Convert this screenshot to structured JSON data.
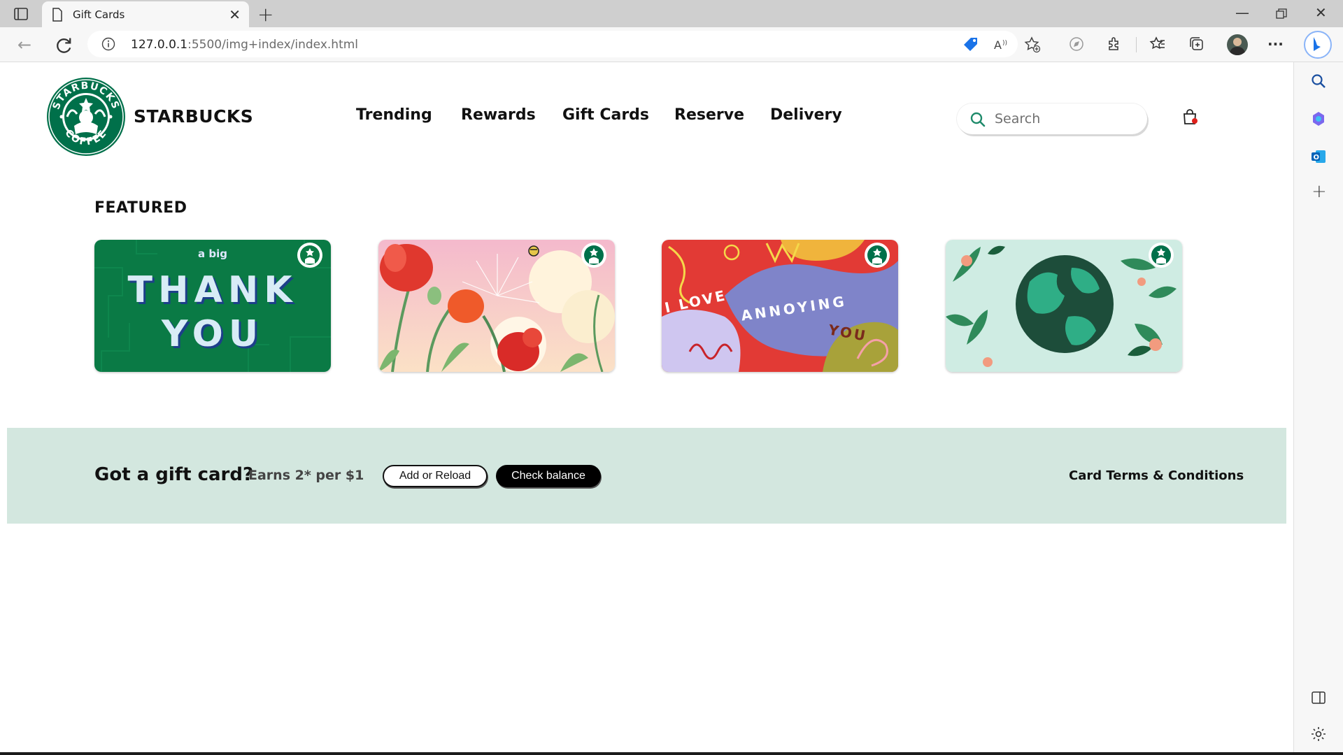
{
  "browser": {
    "tab_title": "Gift Cards",
    "url_host": "127.0.0.1",
    "url_path": ":5500/img+index/index.html"
  },
  "header": {
    "brand": "STARBUCKS",
    "nav": [
      "Trending",
      "Rewards",
      "Gift Cards",
      "Reserve",
      "Delivery"
    ],
    "search_placeholder": "Search"
  },
  "featured": {
    "title": "FEATURED",
    "cards": [
      {
        "name": "thank-you-card",
        "text_small": "a big",
        "text_line1": "THANK",
        "text_line2": "YOU",
        "bg": "#0a7a45"
      },
      {
        "name": "poppy-flowers-card",
        "bg": "#f6c9d2"
      },
      {
        "name": "i-love-annoying-you-card",
        "text_1": "I LOVE",
        "text_2": "ANNOYING",
        "text_3": "YOU",
        "bg": "#e23a35"
      },
      {
        "name": "earth-card",
        "bg": "#cfece3"
      }
    ]
  },
  "giftcard_banner": {
    "headline": "Got a gift card?",
    "earns": "Earns 2* per $1",
    "add_reload": "Add or Reload",
    "check_balance": "Check balance",
    "terms": "Card Terms & Conditions"
  },
  "colors": {
    "starbucks_green": "#00704a",
    "banner_bg": "#d3e7df"
  }
}
